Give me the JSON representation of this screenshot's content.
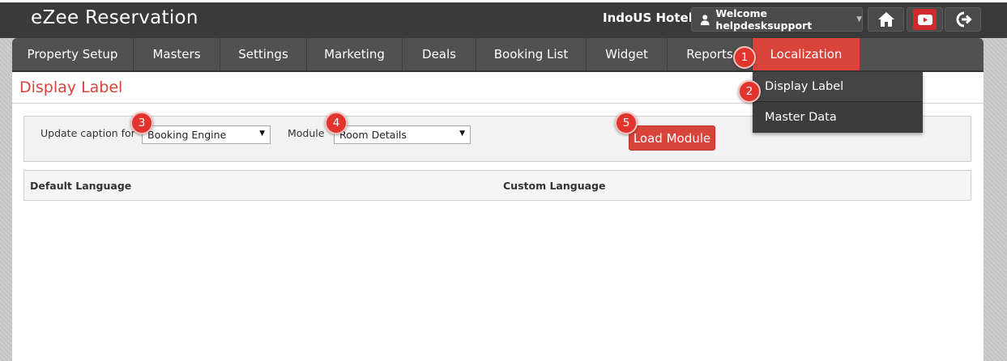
{
  "app": {
    "brand": "eZee Reservation",
    "hotel_name": "IndoUS Hotel",
    "welcome_text": "Welcome helpdesksupport"
  },
  "nav": {
    "items": [
      {
        "label": "Property Setup"
      },
      {
        "label": "Masters"
      },
      {
        "label": "Settings"
      },
      {
        "label": "Marketing"
      },
      {
        "label": "Deals"
      },
      {
        "label": "Booking List"
      },
      {
        "label": "Widget"
      },
      {
        "label": "Reports"
      },
      {
        "label": "Localization",
        "active": true
      }
    ]
  },
  "dropdown": {
    "items": [
      {
        "label": "Display Label"
      },
      {
        "label": "Master Data"
      }
    ]
  },
  "page": {
    "title": "Display Label"
  },
  "filters": {
    "caption_label": "Update caption for",
    "caption_value": "Booking Engine",
    "module_label": "Module",
    "module_value": "Room Details",
    "load_button": "Load Module"
  },
  "table": {
    "columns": [
      "Default Language",
      "Custom Language"
    ]
  },
  "callouts": [
    "1",
    "2",
    "3",
    "4",
    "5"
  ],
  "colors": {
    "accent": "#d9443a",
    "header_bg": "#3a3a3a",
    "nav_bg": "#515151"
  },
  "icons": {
    "user": "user-icon",
    "home": "home-icon",
    "youtube": "youtube-icon",
    "logout": "logout-icon",
    "caret": "caret-down-icon"
  }
}
